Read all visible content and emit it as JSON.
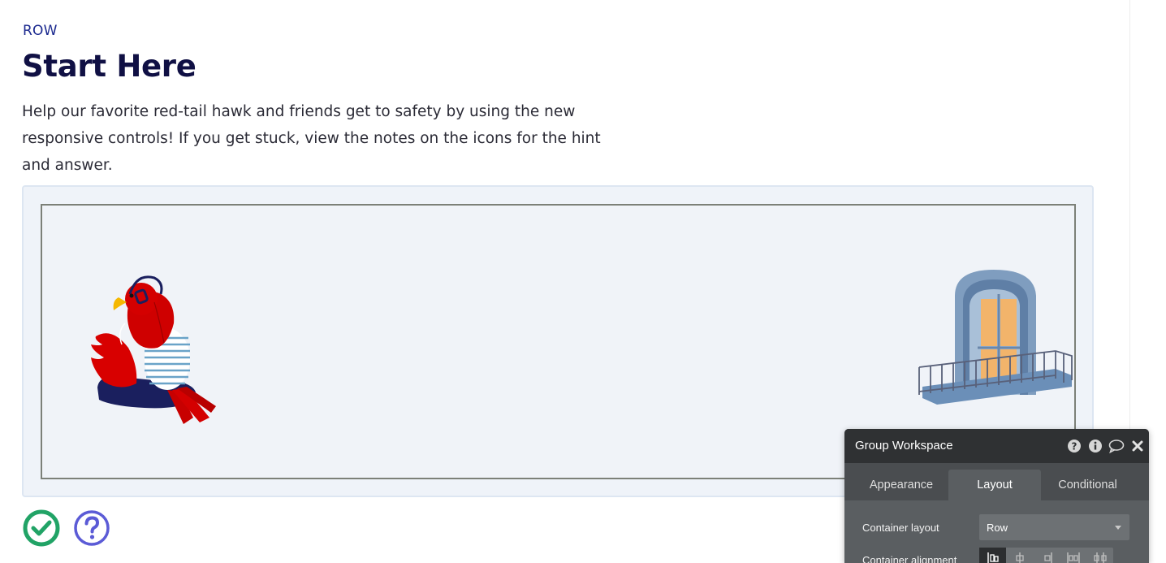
{
  "page": {
    "eyebrow": "ROW",
    "title": "Start Here",
    "description": "Help our favorite red-tail hawk and friends get to safety by using the new responsive controls! If you get stuck, view the notes on the icons for the hint and answer."
  },
  "canvas": {
    "images": [
      "red-tail-hawk-illustration",
      "balcony-window-illustration"
    ]
  },
  "action_icons": [
    "check-circle-icon",
    "question-circle-icon"
  ],
  "colors": {
    "title": "#101044",
    "eyebrow": "#1c2a8f",
    "check_icon": "#21a366",
    "help_icon": "#5b5bd6",
    "editor_header": "#2f3133",
    "editor_body": "#5a5e61"
  },
  "editor": {
    "title": "Group Workspace",
    "header_icons": [
      "help-icon",
      "info-icon",
      "comment-icon",
      "close-icon"
    ],
    "tabs": [
      {
        "label": "Appearance",
        "active": false
      },
      {
        "label": "Layout",
        "active": true
      },
      {
        "label": "Conditional",
        "active": false
      }
    ],
    "container_layout": {
      "label": "Container layout",
      "value": "Row"
    },
    "container_alignment": {
      "label": "Container alignment",
      "options": [
        "align-left-icon",
        "align-center-icon",
        "align-right-icon",
        "align-space-between-icon",
        "align-space-around-icon"
      ],
      "selected": 0
    }
  }
}
